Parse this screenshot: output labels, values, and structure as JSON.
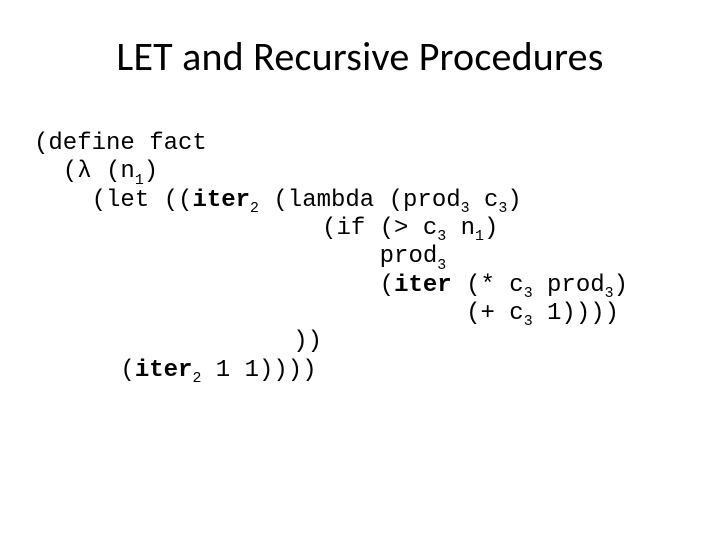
{
  "title": "LET and Recursive Procedures",
  "code": {
    "l1_a": "(define fact",
    "l2_a": "  (",
    "l2_lambda": "λ",
    "l2_b": " (n",
    "l2_sub1": "1",
    "l2_c": ")",
    "l3_a": "    (let ((",
    "l3_iter": "iter",
    "l3_sub2": "2",
    "l3_b": " (lambda (prod",
    "l3_sub3a": "3",
    "l3_c": " c",
    "l3_sub3b": "3",
    "l3_d": ")",
    "l4_a": "                    (if (> c",
    "l4_sub3": "3",
    "l4_b": " n",
    "l4_sub1": "1",
    "l4_c": ")",
    "l5_a": "                        prod",
    "l5_sub3": "3",
    "l6_a": "                        (",
    "l6_iter": "iter",
    "l6_b": " (* c",
    "l6_sub3a": "3",
    "l6_c": " prod",
    "l6_sub3b": "3",
    "l6_d": ")",
    "l7_a": "                              (+ c",
    "l7_sub3": "3",
    "l7_b": " 1))))",
    "l8_a": "                  ))",
    "l9_a": "      (",
    "l9_iter": "iter",
    "l9_sub2": "2",
    "l9_b": " 1 1))))"
  }
}
